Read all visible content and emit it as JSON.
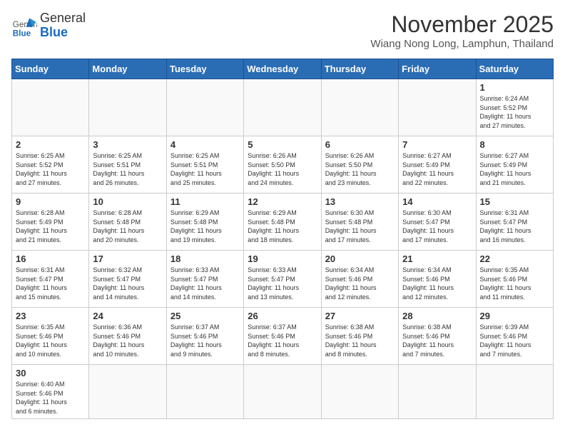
{
  "header": {
    "logo_general": "General",
    "logo_blue": "Blue",
    "month_title": "November 2025",
    "location": "Wiang Nong Long, Lamphun, Thailand"
  },
  "days_of_week": [
    "Sunday",
    "Monday",
    "Tuesday",
    "Wednesday",
    "Thursday",
    "Friday",
    "Saturday"
  ],
  "weeks": [
    [
      {
        "day": "",
        "content": ""
      },
      {
        "day": "",
        "content": ""
      },
      {
        "day": "",
        "content": ""
      },
      {
        "day": "",
        "content": ""
      },
      {
        "day": "",
        "content": ""
      },
      {
        "day": "",
        "content": ""
      },
      {
        "day": "1",
        "content": "Sunrise: 6:24 AM\nSunset: 5:52 PM\nDaylight: 11 hours\nand 27 minutes."
      }
    ],
    [
      {
        "day": "2",
        "content": "Sunrise: 6:25 AM\nSunset: 5:52 PM\nDaylight: 11 hours\nand 27 minutes."
      },
      {
        "day": "3",
        "content": "Sunrise: 6:25 AM\nSunset: 5:51 PM\nDaylight: 11 hours\nand 26 minutes."
      },
      {
        "day": "4",
        "content": "Sunrise: 6:25 AM\nSunset: 5:51 PM\nDaylight: 11 hours\nand 25 minutes."
      },
      {
        "day": "5",
        "content": "Sunrise: 6:26 AM\nSunset: 5:50 PM\nDaylight: 11 hours\nand 24 minutes."
      },
      {
        "day": "6",
        "content": "Sunrise: 6:26 AM\nSunset: 5:50 PM\nDaylight: 11 hours\nand 23 minutes."
      },
      {
        "day": "7",
        "content": "Sunrise: 6:27 AM\nSunset: 5:49 PM\nDaylight: 11 hours\nand 22 minutes."
      },
      {
        "day": "8",
        "content": "Sunrise: 6:27 AM\nSunset: 5:49 PM\nDaylight: 11 hours\nand 21 minutes."
      }
    ],
    [
      {
        "day": "9",
        "content": "Sunrise: 6:28 AM\nSunset: 5:49 PM\nDaylight: 11 hours\nand 21 minutes."
      },
      {
        "day": "10",
        "content": "Sunrise: 6:28 AM\nSunset: 5:48 PM\nDaylight: 11 hours\nand 20 minutes."
      },
      {
        "day": "11",
        "content": "Sunrise: 6:29 AM\nSunset: 5:48 PM\nDaylight: 11 hours\nand 19 minutes."
      },
      {
        "day": "12",
        "content": "Sunrise: 6:29 AM\nSunset: 5:48 PM\nDaylight: 11 hours\nand 18 minutes."
      },
      {
        "day": "13",
        "content": "Sunrise: 6:30 AM\nSunset: 5:48 PM\nDaylight: 11 hours\nand 17 minutes."
      },
      {
        "day": "14",
        "content": "Sunrise: 6:30 AM\nSunset: 5:47 PM\nDaylight: 11 hours\nand 17 minutes."
      },
      {
        "day": "15",
        "content": "Sunrise: 6:31 AM\nSunset: 5:47 PM\nDaylight: 11 hours\nand 16 minutes."
      }
    ],
    [
      {
        "day": "16",
        "content": "Sunrise: 6:31 AM\nSunset: 5:47 PM\nDaylight: 11 hours\nand 15 minutes."
      },
      {
        "day": "17",
        "content": "Sunrise: 6:32 AM\nSunset: 5:47 PM\nDaylight: 11 hours\nand 14 minutes."
      },
      {
        "day": "18",
        "content": "Sunrise: 6:33 AM\nSunset: 5:47 PM\nDaylight: 11 hours\nand 14 minutes."
      },
      {
        "day": "19",
        "content": "Sunrise: 6:33 AM\nSunset: 5:47 PM\nDaylight: 11 hours\nand 13 minutes."
      },
      {
        "day": "20",
        "content": "Sunrise: 6:34 AM\nSunset: 5:46 PM\nDaylight: 11 hours\nand 12 minutes."
      },
      {
        "day": "21",
        "content": "Sunrise: 6:34 AM\nSunset: 5:46 PM\nDaylight: 11 hours\nand 12 minutes."
      },
      {
        "day": "22",
        "content": "Sunrise: 6:35 AM\nSunset: 5:46 PM\nDaylight: 11 hours\nand 11 minutes."
      }
    ],
    [
      {
        "day": "23",
        "content": "Sunrise: 6:35 AM\nSunset: 5:46 PM\nDaylight: 11 hours\nand 10 minutes."
      },
      {
        "day": "24",
        "content": "Sunrise: 6:36 AM\nSunset: 5:46 PM\nDaylight: 11 hours\nand 10 minutes."
      },
      {
        "day": "25",
        "content": "Sunrise: 6:37 AM\nSunset: 5:46 PM\nDaylight: 11 hours\nand 9 minutes."
      },
      {
        "day": "26",
        "content": "Sunrise: 6:37 AM\nSunset: 5:46 PM\nDaylight: 11 hours\nand 8 minutes."
      },
      {
        "day": "27",
        "content": "Sunrise: 6:38 AM\nSunset: 5:46 PM\nDaylight: 11 hours\nand 8 minutes."
      },
      {
        "day": "28",
        "content": "Sunrise: 6:38 AM\nSunset: 5:46 PM\nDaylight: 11 hours\nand 7 minutes."
      },
      {
        "day": "29",
        "content": "Sunrise: 6:39 AM\nSunset: 5:46 PM\nDaylight: 11 hours\nand 7 minutes."
      }
    ],
    [
      {
        "day": "30",
        "content": "Sunrise: 6:40 AM\nSunset: 5:46 PM\nDaylight: 11 hours\nand 6 minutes."
      },
      {
        "day": "",
        "content": ""
      },
      {
        "day": "",
        "content": ""
      },
      {
        "day": "",
        "content": ""
      },
      {
        "day": "",
        "content": ""
      },
      {
        "day": "",
        "content": ""
      },
      {
        "day": "",
        "content": ""
      }
    ]
  ]
}
